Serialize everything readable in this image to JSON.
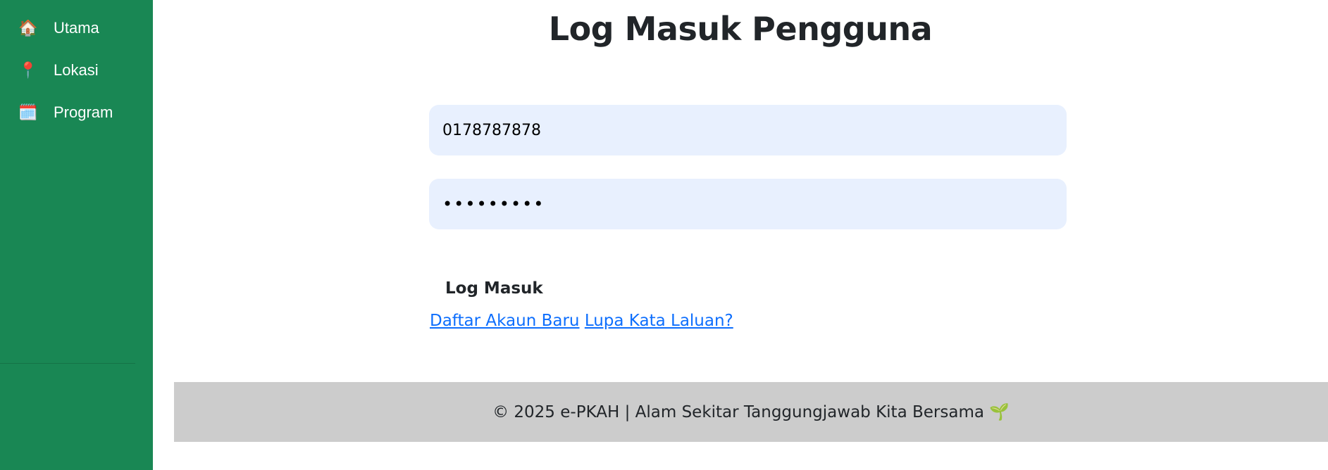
{
  "sidebar": {
    "items": [
      {
        "label": "Utama",
        "icon": "🏠",
        "icon_name": "house-icon"
      },
      {
        "label": "Lokasi",
        "icon": "📍",
        "icon_name": "pin-icon"
      },
      {
        "label": "Program",
        "icon": "🗓️",
        "icon_name": "calendar-icon"
      }
    ]
  },
  "main": {
    "title": "Log Masuk Pengguna",
    "username_value": "0178787878",
    "password_value": "•••••••••",
    "login_label": "Log Masuk",
    "register_link": "Daftar Akaun Baru",
    "forgot_link": "Lupa Kata Laluan?"
  },
  "footer": {
    "text": "© 2025 e-PKAH | Alam Sekitar Tanggungjawab Kita Bersama",
    "icon": "🌱"
  },
  "colors": {
    "sidebar": "#198754",
    "input_bg": "#e8f0fe",
    "link": "#0d6efd",
    "footer_bg": "#cccccc"
  }
}
